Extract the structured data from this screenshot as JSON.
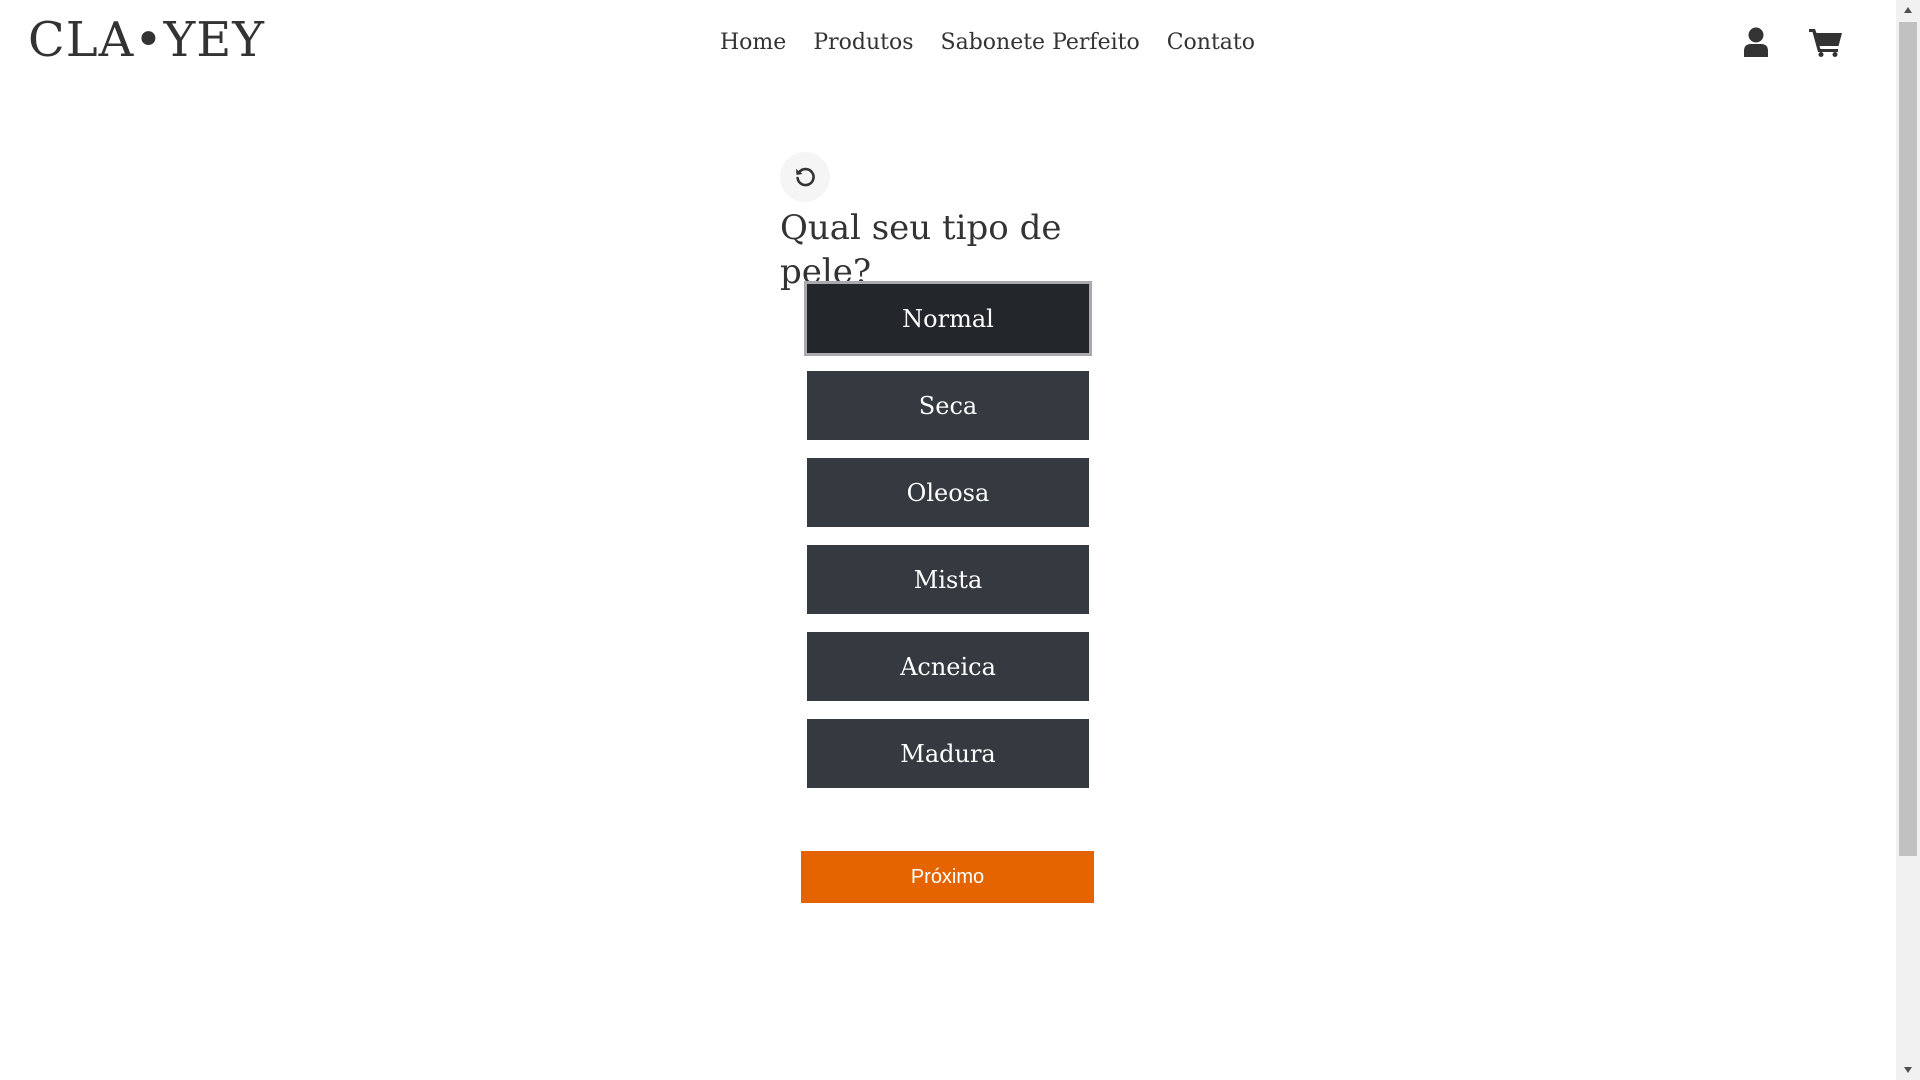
{
  "header": {
    "brand": "CLA•YEY",
    "nav": [
      "Home",
      "Produtos",
      "Sabonete Perfeito",
      "Contato"
    ],
    "icons": [
      "user-icon",
      "cart-icon"
    ]
  },
  "quiz": {
    "reset_icon": "rotate-ccw-icon",
    "question": "Qual seu tipo de pele?",
    "options": [
      "Normal",
      "Seca",
      "Oleosa",
      "Mista",
      "Acneica",
      "Madura"
    ],
    "selected": "Normal",
    "next_label": "Próximo"
  },
  "colors": {
    "option_bg": "#343a40",
    "option_selected_bg": "#23272b",
    "next_bg": "#e56400",
    "text": "#333333"
  }
}
